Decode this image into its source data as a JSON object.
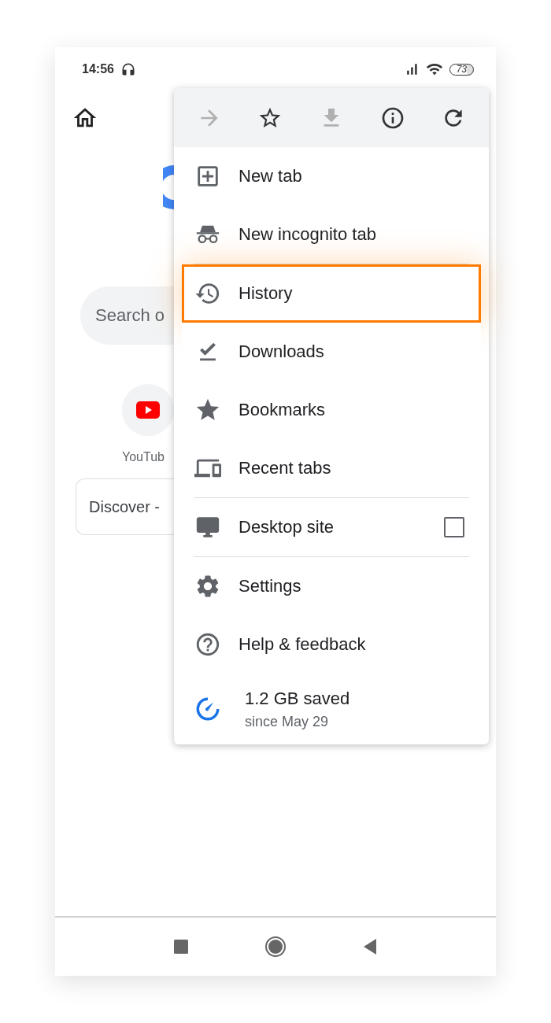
{
  "status_bar": {
    "time": "14:56",
    "battery": "73"
  },
  "page": {
    "search": {
      "placeholder": "Search o"
    },
    "shortcuts": [
      {
        "label": "YouTub"
      }
    ],
    "discover": "Discover -"
  },
  "menu": {
    "toolbar": [
      {
        "disabled": true
      },
      {
        "disabled": false
      },
      {
        "disabled": true
      },
      {
        "disabled": false
      },
      {
        "disabled": false
      }
    ],
    "sections": [
      [
        {
          "kind": "item",
          "label": "New tab",
          "highlighted": false
        },
        {
          "kind": "item",
          "label": "New incognito tab",
          "highlighted": false
        }
      ],
      [
        {
          "kind": "item",
          "label": "History",
          "highlighted": true
        },
        {
          "kind": "item",
          "label": "Downloads",
          "highlighted": false
        },
        {
          "kind": "item",
          "label": "Bookmarks",
          "highlighted": false
        },
        {
          "kind": "item",
          "label": "Recent tabs",
          "highlighted": false
        }
      ],
      [
        {
          "kind": "checkbox",
          "label": "Desktop site",
          "checked": false,
          "highlighted": false
        }
      ],
      [
        {
          "kind": "item",
          "label": "Settings",
          "highlighted": false
        },
        {
          "kind": "item",
          "label": "Help & feedback",
          "highlighted": false
        },
        {
          "kind": "saved",
          "label": "1.2 GB saved",
          "sublabel": "since May 29",
          "highlighted": false
        }
      ]
    ]
  }
}
